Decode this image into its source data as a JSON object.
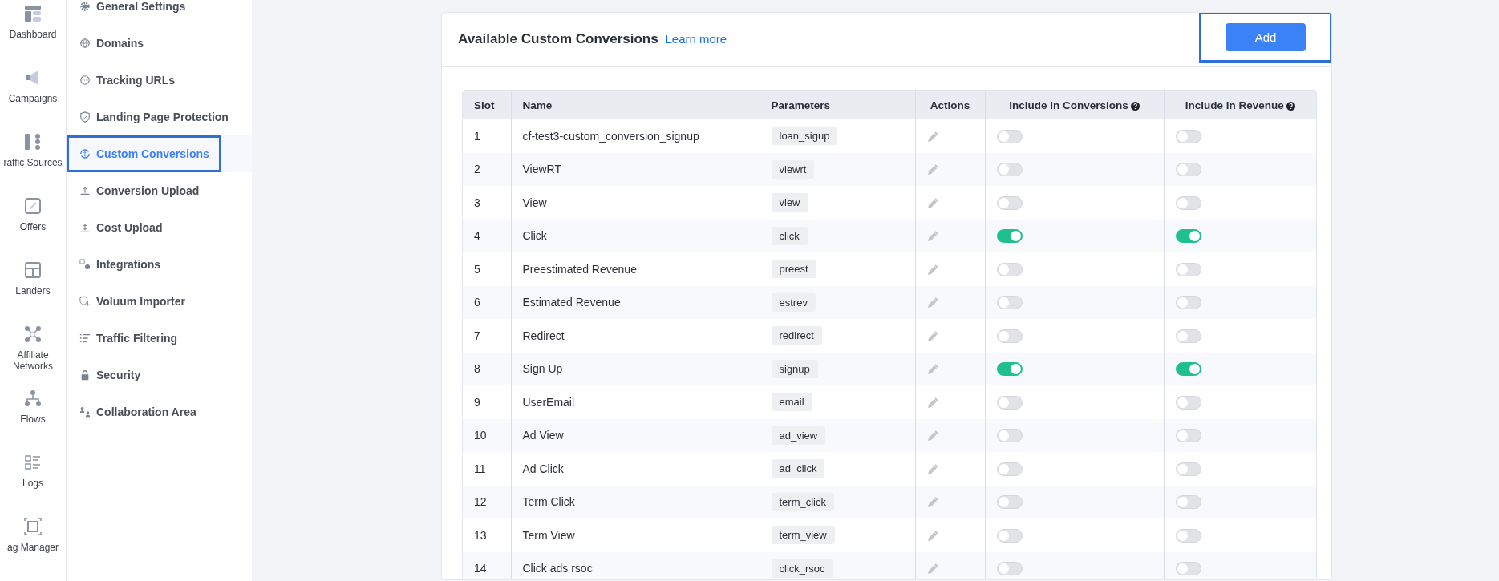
{
  "icon_sidebar": {
    "items": [
      {
        "label": "Dashboard"
      },
      {
        "label": "Campaigns"
      },
      {
        "label": "raffic Sources"
      },
      {
        "label": "Offers"
      },
      {
        "label": "Landers"
      },
      {
        "label": "Affiliate Networks"
      },
      {
        "label": "Flows"
      },
      {
        "label": "Logs"
      },
      {
        "label": "ag Manager"
      }
    ]
  },
  "settings_nav": {
    "items": [
      {
        "label": "General Settings",
        "selected": false
      },
      {
        "label": "Domains",
        "selected": false
      },
      {
        "label": "Tracking URLs",
        "selected": false
      },
      {
        "label": "Landing Page Protection",
        "selected": false
      },
      {
        "label": "Custom Conversions",
        "selected": true
      },
      {
        "label": "Conversion Upload",
        "selected": false
      },
      {
        "label": "Cost Upload",
        "selected": false
      },
      {
        "label": "Integrations",
        "selected": false
      },
      {
        "label": "Voluum Importer",
        "selected": false
      },
      {
        "label": "Traffic Filtering",
        "selected": false
      },
      {
        "label": "Security",
        "selected": false
      },
      {
        "label": "Collaboration Area",
        "selected": false
      }
    ]
  },
  "card": {
    "title": "Available Custom Conversions",
    "link": "Learn more",
    "add_button": "Add",
    "table": {
      "columns": [
        {
          "label": "Slot",
          "help": false
        },
        {
          "label": "Name",
          "help": false
        },
        {
          "label": "Parameters",
          "help": false
        },
        {
          "label": "Actions",
          "help": false
        },
        {
          "label": "Include in Conversions",
          "help": true
        },
        {
          "label": "Include in Revenue",
          "help": true
        }
      ],
      "rows": [
        {
          "slot": "1",
          "name": "cf-test3-custom_conversion_signup",
          "parameter": "loan_sigup",
          "include_in_conversions": false,
          "include_in_revenue": false
        },
        {
          "slot": "2",
          "name": "ViewRT",
          "parameter": "viewrt",
          "include_in_conversions": false,
          "include_in_revenue": false
        },
        {
          "slot": "3",
          "name": "View",
          "parameter": "view",
          "include_in_conversions": false,
          "include_in_revenue": false
        },
        {
          "slot": "4",
          "name": "Click",
          "parameter": "click",
          "include_in_conversions": true,
          "include_in_revenue": true
        },
        {
          "slot": "5",
          "name": "Preestimated Revenue",
          "parameter": "preest",
          "include_in_conversions": false,
          "include_in_revenue": false
        },
        {
          "slot": "6",
          "name": "Estimated Revenue",
          "parameter": "estrev",
          "include_in_conversions": false,
          "include_in_revenue": false
        },
        {
          "slot": "7",
          "name": "Redirect",
          "parameter": "redirect",
          "include_in_conversions": false,
          "include_in_revenue": false
        },
        {
          "slot": "8",
          "name": "Sign Up",
          "parameter": "signup",
          "include_in_conversions": true,
          "include_in_revenue": true
        },
        {
          "slot": "9",
          "name": "UserEmail",
          "parameter": "email",
          "include_in_conversions": false,
          "include_in_revenue": false
        },
        {
          "slot": "10",
          "name": "Ad View",
          "parameter": "ad_view",
          "include_in_conversions": false,
          "include_in_revenue": false
        },
        {
          "slot": "11",
          "name": "Ad Click",
          "parameter": "ad_click",
          "include_in_conversions": false,
          "include_in_revenue": false
        },
        {
          "slot": "12",
          "name": "Term Click",
          "parameter": "term_click",
          "include_in_conversions": false,
          "include_in_revenue": false
        },
        {
          "slot": "13",
          "name": "Term View",
          "parameter": "term_view",
          "include_in_conversions": false,
          "include_in_revenue": false
        },
        {
          "slot": "14",
          "name": "Click ads rsoc",
          "parameter": "click_rsoc",
          "include_in_conversions": false,
          "include_in_revenue": false
        }
      ]
    }
  }
}
